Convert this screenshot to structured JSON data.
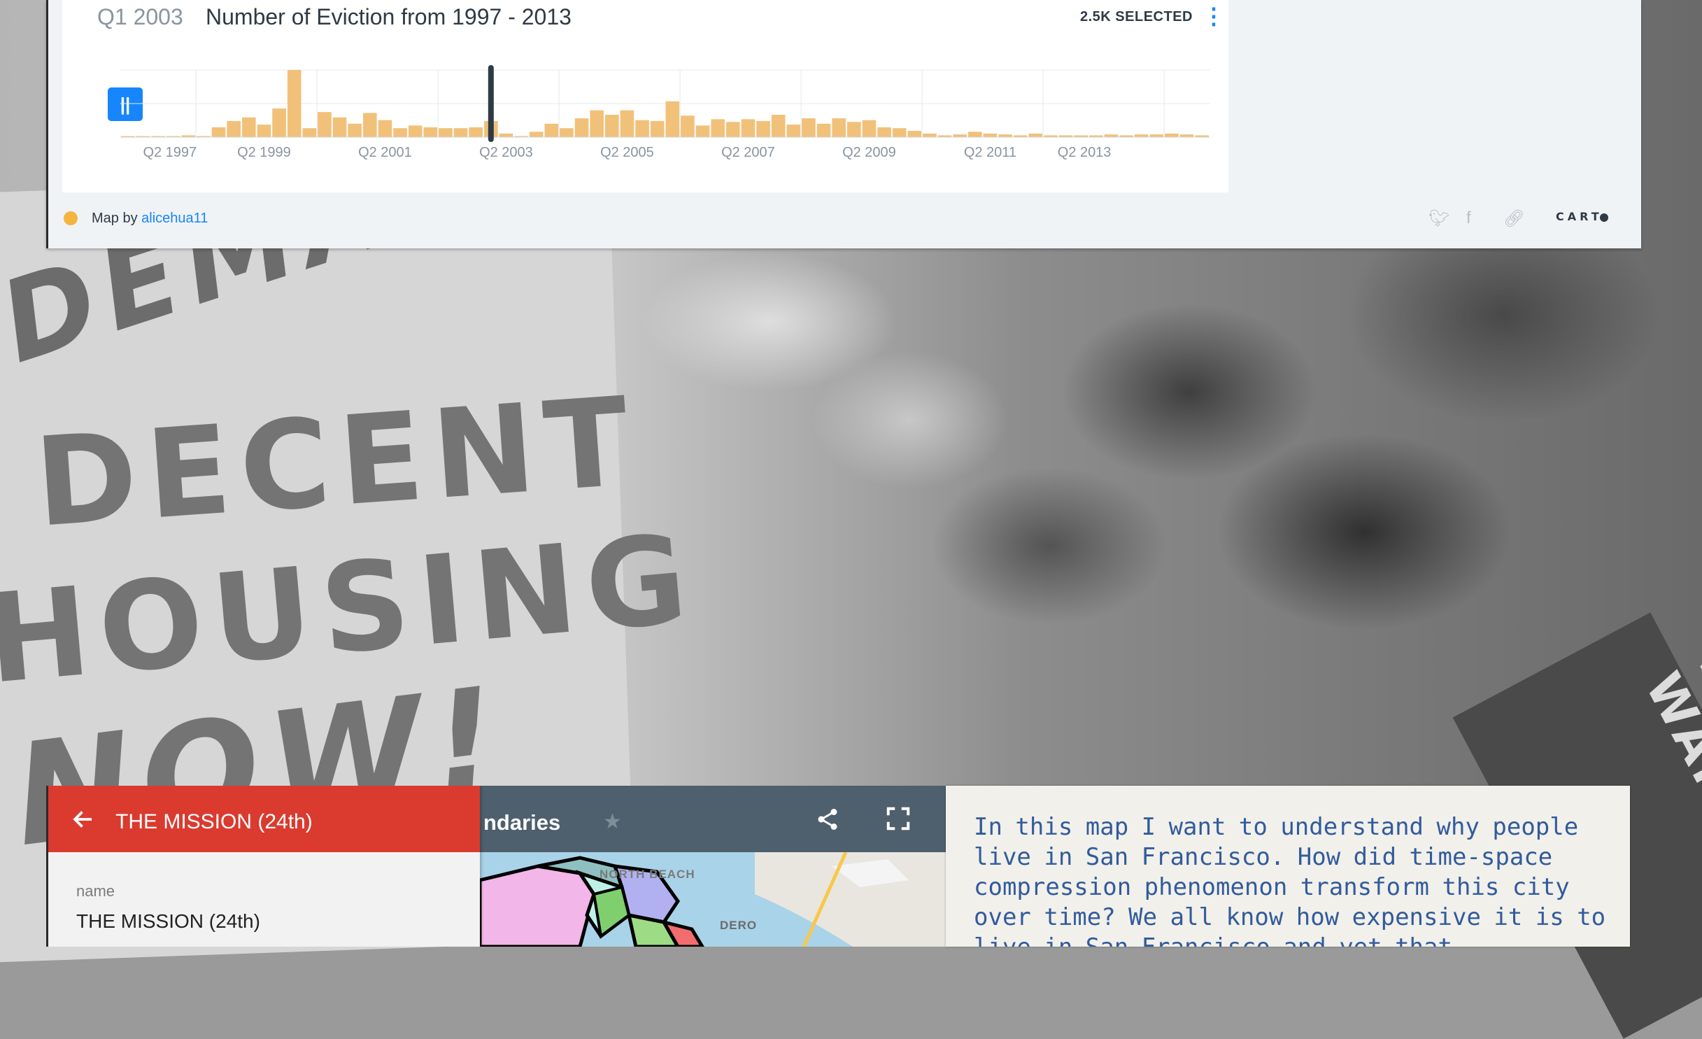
{
  "widget": {
    "current_range": "Q1 2003",
    "title": "Number of Eviction from 1997 - 2013",
    "selected_count": "2.5K SELECTED",
    "menu_icon": "more-vertical-icon",
    "play_button_icon": "pause-icon",
    "play_button_label": "||"
  },
  "chart_data": {
    "type": "bar",
    "title": "Number of Eviction from 1997 - 2013",
    "x_tick_labels": [
      "Q2 1997",
      "Q2 1999",
      "Q2 2001",
      "Q2 2003",
      "Q2 2005",
      "Q2 2007",
      "Q2 2009",
      "Q2 2011",
      "Q2 2013"
    ],
    "quarters_start": "Q1 1997",
    "values": [
      1,
      1,
      1,
      1,
      2,
      1,
      11,
      18,
      22,
      14,
      32,
      75,
      10,
      28,
      22,
      15,
      27,
      19,
      10,
      13,
      11,
      10,
      10,
      11,
      18,
      4,
      1,
      6,
      15,
      10,
      21,
      30,
      25,
      30,
      19,
      18,
      40,
      24,
      13,
      20,
      17,
      20,
      18,
      25,
      14,
      21,
      15,
      21,
      17,
      19,
      11,
      10,
      7,
      4,
      2,
      3,
      6,
      4,
      3,
      2,
      4,
      2,
      2,
      2,
      2,
      3,
      2,
      3,
      3,
      4,
      3,
      2
    ],
    "selected_until": "Q1 2003",
    "bar_color": "#f1c17a",
    "ylim": [
      0,
      75
    ],
    "grid": true
  },
  "footer": {
    "map_by_label": "Map by",
    "author": "alicehua11",
    "twitter_icon": "twitter-icon",
    "facebook_icon": "facebook-icon",
    "link_icon": "link-icon",
    "brand": "CART"
  },
  "map_panel": {
    "title": "ndaries",
    "star_icon": "star-icon",
    "share_icon": "share-icon",
    "fullscreen_icon": "fullscreen-icon",
    "map_labels": [
      "NORTH BEACH",
      "DERO"
    ]
  },
  "side_panel": {
    "back_icon": "arrow-left-icon",
    "header_title": "THE MISSION (24th)",
    "field_label": "name",
    "field_value": "THE MISSION (24th)"
  },
  "text_card": {
    "body": "In this map I want to understand why people live in San Francisco. How did time-space compression phenomenon transform this city over time? We all know how expensive it is to live in San Francisco and yet that"
  },
  "background": {
    "sign_text_top": "DEMAN",
    "sign_text_1": "DECENT",
    "sign_text_2": "HOUSING",
    "sign_text_3": "NOW!",
    "sign_text_right": "WE WANT"
  }
}
